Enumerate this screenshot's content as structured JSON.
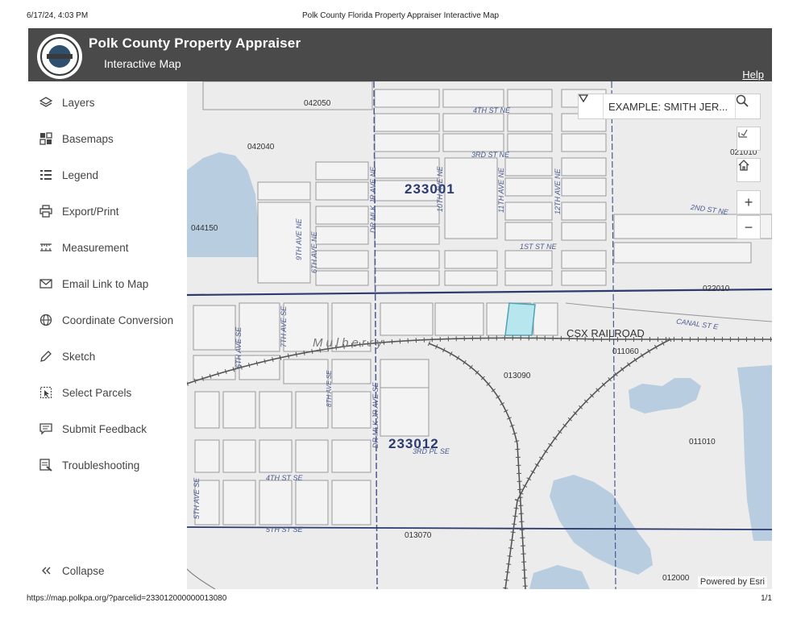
{
  "print": {
    "datetime": "6/17/24, 4:03 PM",
    "page_title": "Polk County Florida Property Appraiser Interactive Map",
    "url": "https://map.polkpa.org/?parcelid=233012000000013080",
    "page_num": "1/1"
  },
  "header": {
    "title": "Polk County Property Appraiser",
    "subtitle": "Interactive Map",
    "help": "Help"
  },
  "sidebar": {
    "items": [
      {
        "label": "Layers",
        "icon": "layers-icon"
      },
      {
        "label": "Basemaps",
        "icon": "basemaps-icon"
      },
      {
        "label": "Legend",
        "icon": "legend-icon"
      },
      {
        "label": "Export/Print",
        "icon": "printer-icon"
      },
      {
        "label": "Measurement",
        "icon": "ruler-icon"
      },
      {
        "label": "Email Link to Map",
        "icon": "envelope-icon"
      },
      {
        "label": "Coordinate Conversion",
        "icon": "globe-icon"
      },
      {
        "label": "Sketch",
        "icon": "pencil-icon"
      },
      {
        "label": "Select Parcels",
        "icon": "select-icon"
      },
      {
        "label": "Submit Feedback",
        "icon": "speech-bubble-icon"
      },
      {
        "label": "Troubleshooting",
        "icon": "troubleshoot-icon"
      }
    ],
    "collapse": "Collapse"
  },
  "search": {
    "placeholder": "EXAMPLE: SMITH JER..."
  },
  "map": {
    "zoom_in": "+",
    "zoom_out": "−",
    "attribution": "Powered by Esri",
    "section_labels": [
      "233001",
      "233012"
    ],
    "place_label": "Mulberry",
    "railroad_label": "CSX RAILROAD",
    "parcel_labels": [
      "042050",
      "042040",
      "044150",
      "021010",
      "022010",
      "011060",
      "013090",
      "011010",
      "013070",
      "012000"
    ],
    "street_labels": [
      "4TH ST NE",
      "3RD ST NE",
      "2ND ST NE",
      "1ST ST NE",
      "CANAL ST E",
      "4TH ST SE",
      "5TH ST SE",
      "3RD PL SE",
      "9TH AVE NE",
      "10TH AVE NE",
      "11TH AVE NE",
      "12TH AVE NE",
      "6TH AVE NE",
      "6TH AVE SE",
      "7TH AVE SE",
      "8TH AVE SE",
      "5TH AVE SE",
      "DR MLK JR AVE NE",
      "DR MLK JR AVE SE"
    ],
    "colors": {
      "water": "#b8cde0",
      "highlight": "#b8e6ee",
      "parcel_line": "#9a9a9a",
      "road_line": "#2c3a6e"
    }
  }
}
